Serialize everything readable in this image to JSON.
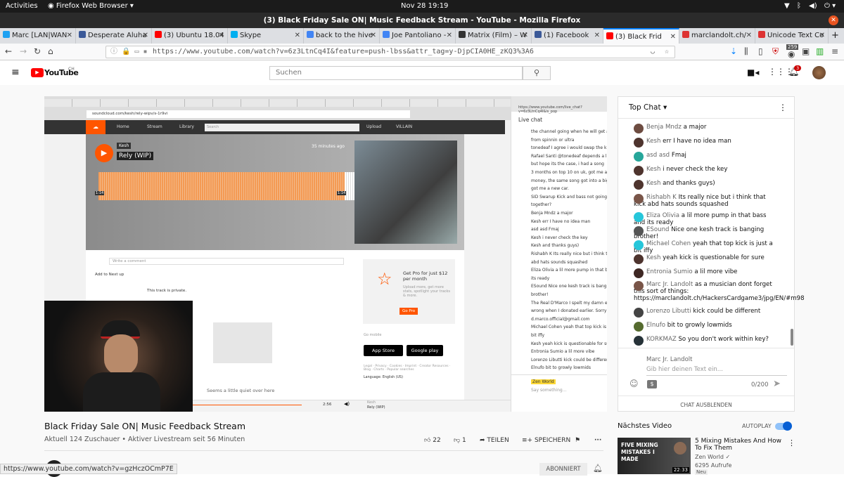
{
  "system": {
    "activities": "Activities",
    "app": "Firefox Web Browser",
    "clock": "Nov 28  19:19"
  },
  "window": {
    "title": "(3) Black Friday Sale ON| Music Feedback Stream - YouTube - Mozilla Firefox"
  },
  "tabs": [
    {
      "label": "Marc [LAN|WAN",
      "color": "#1da1f2"
    },
    {
      "label": "Desperate Aluha",
      "color": "#3b5998"
    },
    {
      "label": "(3) Ubuntu 18.04",
      "color": "#ff0000"
    },
    {
      "label": "Skype",
      "color": "#00aff0"
    },
    {
      "label": "back to the hive",
      "color": "#4285f4"
    },
    {
      "label": "Joe Pantoliano - ",
      "color": "#4285f4"
    },
    {
      "label": "Matrix (Film) – W",
      "color": "#333"
    },
    {
      "label": "(1) Facebook",
      "color": "#3b5998"
    },
    {
      "label": "(3) Black Frid",
      "color": "#ff0000"
    },
    {
      "label": "marclandolt.ch/",
      "color": "#d33"
    },
    {
      "label": "Unicode Text Co",
      "color": "#d33"
    }
  ],
  "nav": {
    "url": "https://www.youtube.com/watch?v=6z3LtnCq4I&feature=push-lbss&attr_tag=y-DjpCIA0HE_zKQ3%3A6",
    "badge": "259"
  },
  "youtube": {
    "logo": "YouTube",
    "logo_region": "CH",
    "search_placeholder": "Suchen",
    "notif_count": "3"
  },
  "soundcloud": {
    "url": "soundcloud.com/kesh/rely-wipv/s-1r9vi",
    "nav": [
      "Home",
      "Stream",
      "Library"
    ],
    "search": "Search",
    "upload": "Upload",
    "user": "VILLAIN",
    "artist": "Kesh",
    "track": "Rely (WIP)",
    "time": "35 minutes ago",
    "t_start": "1:14",
    "t_end": "1:14",
    "comment_placeholder": "Write a comment",
    "add_next": "Add to Next up",
    "private": "This track is private.",
    "pro_title": "Get Pro for just $12 per month",
    "pro_text": "Upload more, get more stats, spotlight your tracks & more.",
    "pro_btn": "Go Pro",
    "go_mobile": "Go mobile",
    "appstore": "App Store",
    "gplay": "Google play",
    "quiet": "Seems a little quiet over here",
    "player_time": "2:56",
    "player_artist": "Kesh",
    "player_track": "Rely (WIP)",
    "legal": "Legal · Privacy · Cookies · Imprint · Creator Resources · Blog · Charts · Popular searches",
    "language": "Language: English (US)"
  },
  "mini_chat": {
    "url": "https://www.youtube.com/live_chat?v=6z3LtnCq4I&is_pop",
    "label": "Live chat",
    "lines": [
      "the channel going when he will get a de",
      "from spinnin or ultra",
      "tonedeaf  I agree i would swap the k",
      "Rafael Santi  @tonedeaf depends a lot",
      "but hope its the case, i had a song",
      "3 months on top 10 on uk, got me almo",
      "money, the same song got into a big m",
      "got me a new car.",
      "SID Swarup  Kick and bass not going",
      "together?",
      "Benja Mndz  a major",
      "Kesh  err I have no idea man",
      "asd asd  Fmaj",
      "Kesh  i never check the key",
      "Kesh  and thanks guys)",
      "Rishabh K  Its really nice but i think that",
      "abd hats sounds squashed",
      "Eliza Olivia  a lil more pump in that bas",
      "its ready",
      "ESound  Nice one kesh track is banging",
      "brother!",
      "The Real D'Marco  I spelt my damn ema",
      "wrong when I donated earlier. Sorry Zen",
      "d.marco.official@gmail.com",
      "Michael Cohen  yeah that top kick is jus",
      "bit iffy",
      "Kesh  yeah kick is questionable for sure",
      "Entronia Sumio  a lil more vibe",
      "Lorenzo Libutti  kick could be different",
      "Elnufo  bit to growly lowmids"
    ],
    "input_user": "Zen World",
    "input_ph": "Say something…"
  },
  "chat": {
    "header": "Top Chat",
    "messages": [
      {
        "author": "Benja Mndz",
        "text": "a major",
        "color": "#6d4c41"
      },
      {
        "author": "Kesh",
        "text": "err I have no idea man",
        "color": "#4e342e"
      },
      {
        "author": "asd asd",
        "text": "Fmaj",
        "color": "#26a69a"
      },
      {
        "author": "Kesh",
        "text": "i never check the key",
        "color": "#4e342e"
      },
      {
        "author": "Kesh",
        "text": "and thanks guys)",
        "color": "#4e342e"
      },
      {
        "author": "Rishabh K",
        "text": "Its really nice but i think that kick abd hats sounds squashed",
        "color": "#795548"
      },
      {
        "author": "Eliza Olivia",
        "text": "a lil more pump in that bass and its ready",
        "color": "#26c6da"
      },
      {
        "author": "ESound",
        "text": "Nice one kesh track is banging brother!",
        "color": "#555"
      },
      {
        "author": "Michael Cohen",
        "text": "yeah that top kick is just a bit iffy",
        "color": "#26c6da"
      },
      {
        "author": "Kesh",
        "text": "yeah kick is questionable for sure",
        "color": "#4e342e"
      },
      {
        "author": "Entronia Sumio",
        "text": "a lil more vibe",
        "color": "#3e2723"
      },
      {
        "author": "Marc Jr. Landolt",
        "text": "as a musician dont forget this sort of things: https://marclandolt.ch/HackersCardgame3/jpg/EN/#m98",
        "color": "#795548"
      },
      {
        "author": "Lorenzo Libutti",
        "text": "kick could be different",
        "color": "#444"
      },
      {
        "author": "Elnufo",
        "text": "bit to growly lowmids",
        "color": "#556b2f"
      },
      {
        "author": "KORKMAZ",
        "text": "So you don't work within key?",
        "color": "#263238"
      }
    ],
    "input_user": "Marc Jr. Landolt",
    "input_ph": "Gib hier deinen Text ein...",
    "counter": "0/200",
    "hide": "CHAT AUSBLENDEN"
  },
  "video": {
    "title": "Black Friday Sale ON| Music Feedback Stream",
    "meta": "Aktuell 124 Zuschauer • Aktiver Livestream seit 56 Minuten",
    "likes": "22",
    "dislikes": "1",
    "share": "TEILEN",
    "save": "SPEICHERN",
    "subscribe": "ABONNIERT"
  },
  "next": {
    "header": "Nächstes Video",
    "autoplay": "AUTOPLAY",
    "title": "5 Mixing Mistakes And How To Fix Them",
    "channel": "Zen World",
    "views": "6295 Aufrufe",
    "badge": "Neu",
    "thumb_text": "FIVE MIXING MISTAKES I MADE",
    "duration": "22:33"
  },
  "status_url": "https://www.youtube.com/watch?v=gzHczOCmP7E"
}
